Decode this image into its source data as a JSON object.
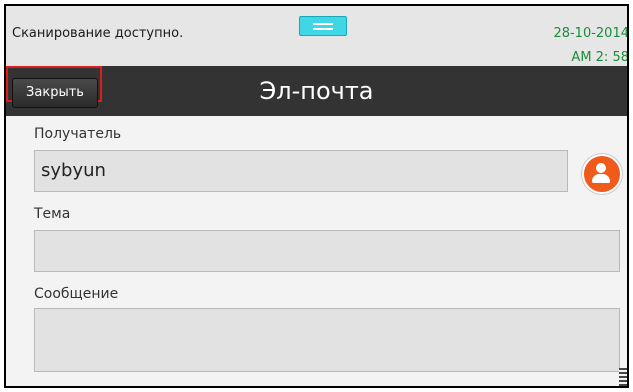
{
  "status": {
    "text": "Сканирование доступно.",
    "date": "28-10-2014",
    "time": "AM 2: 58"
  },
  "header": {
    "close_label": "Закрыть",
    "title": "Эл-почта"
  },
  "form": {
    "recipient_label": "Получатель",
    "recipient_value": "sybyun",
    "subject_label": "Тема",
    "subject_value": "",
    "message_label": "Сообщение",
    "message_value": ""
  },
  "icons": {
    "contact": "person-icon",
    "handle": "menu-handle-icon"
  },
  "colors": {
    "highlight": "#e01b1b",
    "contact_button": "#f05a1a",
    "status_datetime": "#1a8c3a",
    "handle": "#3fd6e5"
  }
}
